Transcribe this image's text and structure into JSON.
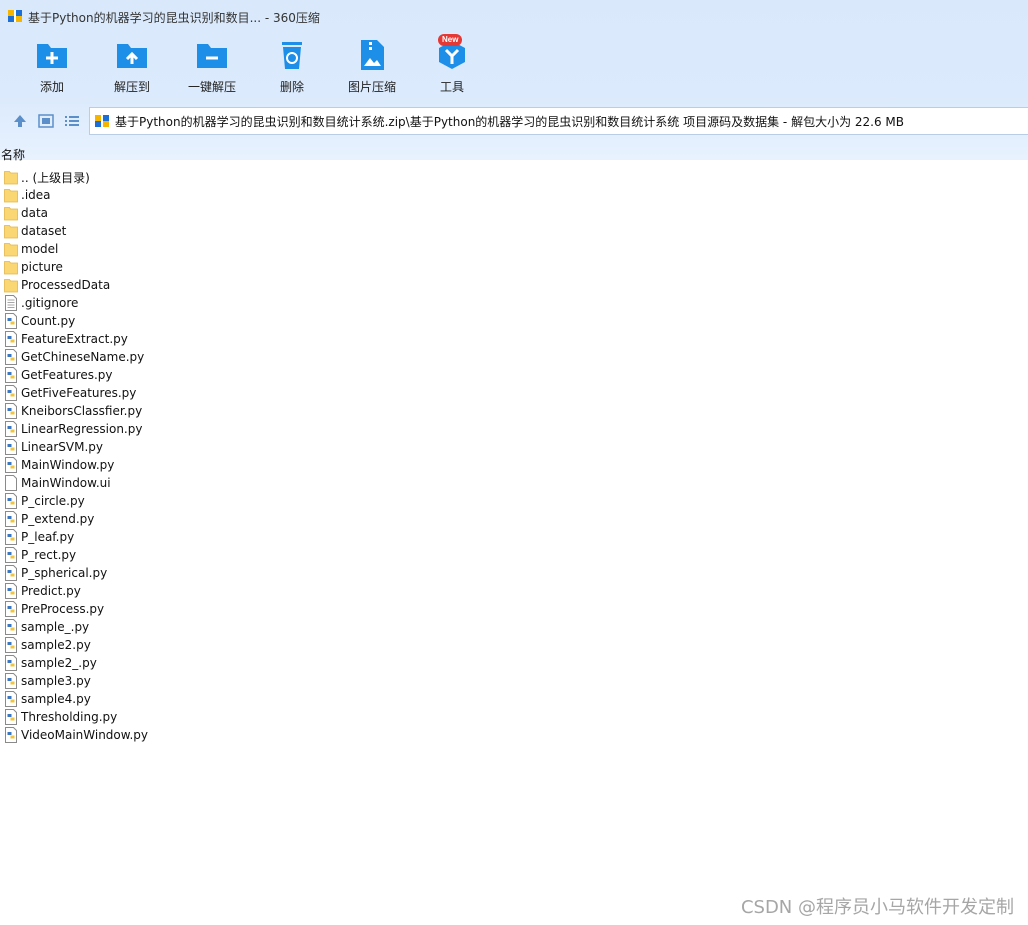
{
  "window": {
    "title": "基于Python的机器学习的昆虫识别和数目... - 360压缩"
  },
  "toolbar": {
    "add": "添加",
    "extract_to": "解压到",
    "one_click_extract": "一键解压",
    "delete": "删除",
    "image_compress": "图片压缩",
    "tools": "工具",
    "tools_badge": "New"
  },
  "address": {
    "path": "基于Python的机器学习的昆虫识别和数目统计系统.zip\\基于Python的机器学习的昆虫识别和数目统计系统 项目源码及数据集 - 解包大小为 22.6 MB"
  },
  "list": {
    "column_name": "名称",
    "items": [
      {
        "name": ".. (上级目录)",
        "type": "folder"
      },
      {
        "name": ".idea",
        "type": "folder"
      },
      {
        "name": "data",
        "type": "folder"
      },
      {
        "name": "dataset",
        "type": "folder"
      },
      {
        "name": "model",
        "type": "folder"
      },
      {
        "name": "picture",
        "type": "folder"
      },
      {
        "name": "ProcessedData",
        "type": "folder"
      },
      {
        "name": ".gitignore",
        "type": "text"
      },
      {
        "name": "Count.py",
        "type": "python"
      },
      {
        "name": "FeatureExtract.py",
        "type": "python"
      },
      {
        "name": "GetChineseName.py",
        "type": "python"
      },
      {
        "name": "GetFeatures.py",
        "type": "python"
      },
      {
        "name": "GetFiveFeatures.py",
        "type": "python"
      },
      {
        "name": "KneiborsClassfier.py",
        "type": "python"
      },
      {
        "name": "LinearRegression.py",
        "type": "python"
      },
      {
        "name": "LinearSVM.py",
        "type": "python"
      },
      {
        "name": "MainWindow.py",
        "type": "python"
      },
      {
        "name": "MainWindow.ui",
        "type": "blank"
      },
      {
        "name": "P_circle.py",
        "type": "python"
      },
      {
        "name": "P_extend.py",
        "type": "python"
      },
      {
        "name": "P_leaf.py",
        "type": "python"
      },
      {
        "name": "P_rect.py",
        "type": "python"
      },
      {
        "name": "P_spherical.py",
        "type": "python"
      },
      {
        "name": "Predict.py",
        "type": "python"
      },
      {
        "name": "PreProcess.py",
        "type": "python"
      },
      {
        "name": "sample_.py",
        "type": "python"
      },
      {
        "name": "sample2.py",
        "type": "python"
      },
      {
        "name": "sample2_.py",
        "type": "python"
      },
      {
        "name": "sample3.py",
        "type": "python"
      },
      {
        "name": "sample4.py",
        "type": "python"
      },
      {
        "name": "Thresholding.py",
        "type": "python"
      },
      {
        "name": "VideoMainWindow.py",
        "type": "python"
      }
    ]
  },
  "watermark": "CSDN @程序员小马软件开发定制",
  "colors": {
    "accent": "#1d8fe8",
    "folder": "#fbd774",
    "chrome_bg": "#dbeafc"
  }
}
